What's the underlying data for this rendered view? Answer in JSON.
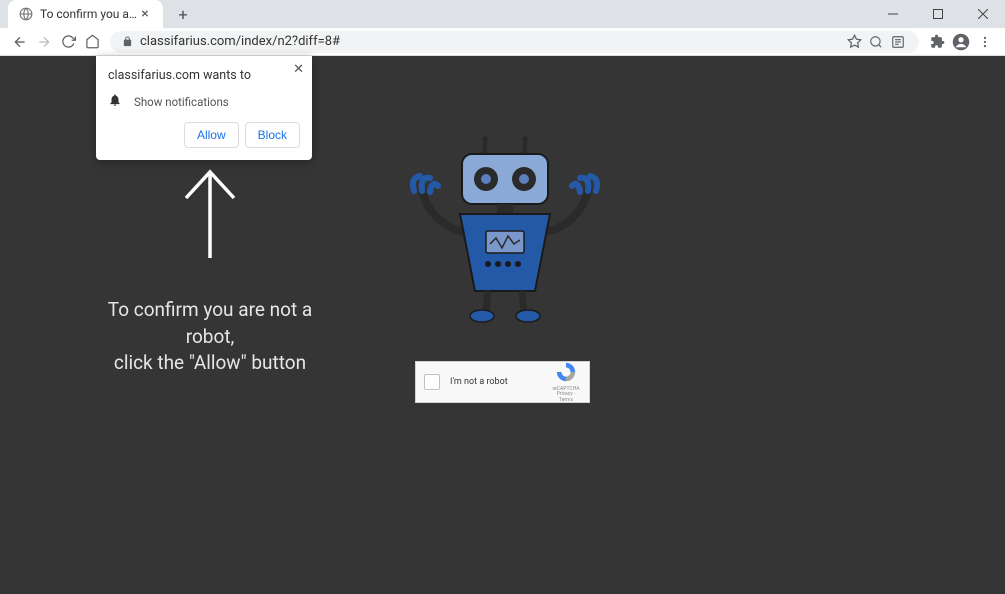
{
  "window": {
    "tab_title": "To confirm you are not a robot, c"
  },
  "toolbar": {
    "url": "classifarius.com/index/n2?diff=8#"
  },
  "notification": {
    "title": "classifarius.com wants to",
    "permission": "Show notifications",
    "allow": "Allow",
    "block": "Block"
  },
  "page": {
    "line1": "To confirm you are not a robot,",
    "line2": "click the \"Allow\" button"
  },
  "recaptcha": {
    "label": "I'm not a robot",
    "brand": "reCAPTCHA",
    "links": "Privacy - Terms"
  }
}
